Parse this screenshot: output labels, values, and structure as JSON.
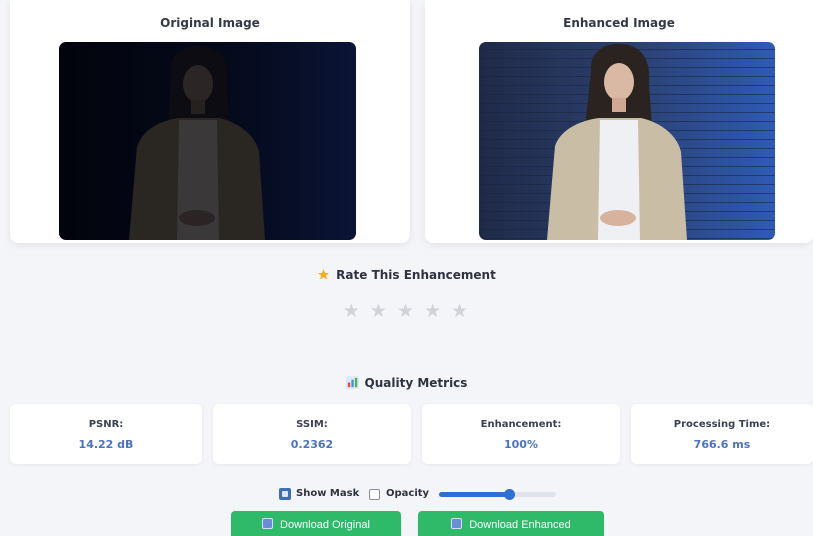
{
  "comparison": {
    "original_title": "Original Image",
    "enhanced_title": "Enhanced Image"
  },
  "rating": {
    "icon": "star-badge-icon",
    "title": "Rate This Enhancement",
    "max_stars": 5,
    "selected_stars": 0,
    "star_glyph": "★"
  },
  "metrics": {
    "icon": "bar-chart-icon",
    "title": "Quality Metrics",
    "items": [
      {
        "label": "PSNR:",
        "value": "14.22 dB"
      },
      {
        "label": "SSIM:",
        "value": "0.2362"
      },
      {
        "label": "Enhancement:",
        "value": "100%"
      },
      {
        "label": "Processing Time:",
        "value": "766.6 ms"
      }
    ]
  },
  "controls": {
    "show_mask_label": "Show Mask",
    "show_mask_checked": false,
    "opacity_label": "Opacity",
    "opacity_value": 0.6
  },
  "buttons": {
    "download_original": "Download Original",
    "download_enhanced": "Download Enhanced"
  },
  "colors": {
    "accent_blue": "#2f6ed6",
    "metric_value": "#4a73c4",
    "button_green": "#2fba6a",
    "star_empty": "#d0d3d9"
  }
}
